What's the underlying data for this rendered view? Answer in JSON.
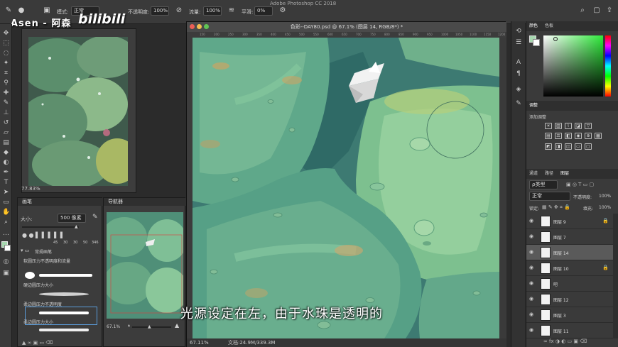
{
  "app": {
    "title": "Adobe Photoshop CC 2018"
  },
  "watermark": {
    "name": "Asen - 阿森",
    "logo": "bilibili"
  },
  "options_bar": {
    "mode_label": "模式:",
    "mode_value": "正常",
    "opacity_label": "不透明度:",
    "opacity_value": "100%",
    "flow_label": "流量:",
    "flow_value": "100%",
    "smooth_label": "平滑:",
    "smooth_value": "0%"
  },
  "reference_doc": {
    "zoom": "77.83%"
  },
  "brush_panel": {
    "tab": "画笔",
    "size_label": "大小:",
    "size_value": "500 像素",
    "preset_sizes": [
      "45",
      "30",
      "30",
      "50",
      "346"
    ],
    "group_name": "常规画笔",
    "items": [
      "软圆压力不透明度和流量",
      "硬边圆压力大小",
      "柔边圆压力不透明度",
      "柔边圆压力大小"
    ]
  },
  "navigator": {
    "tab": "导航器",
    "zoom": "67.1%"
  },
  "document": {
    "title": "色彩--DAY80.psd @ 67.1% (图层 14, RGB/8*) *",
    "status_zoom": "67.11%",
    "status_doc": "文档:24.9M/339.3M",
    "ruler_marks": [
      "150",
      "200",
      "250",
      "300",
      "350",
      "400",
      "450",
      "500",
      "550",
      "600",
      "650",
      "700",
      "750",
      "800",
      "850",
      "900",
      "950",
      "1000",
      "1050",
      "1100",
      "1150",
      "1200"
    ]
  },
  "subtitle": "光源设定在左，由于水珠是透明的",
  "right_panels": {
    "color_tabs": [
      "颜色",
      "色板"
    ],
    "adjust_tab": "调整",
    "adjust_add": "添加调整",
    "layer_tabs": [
      "通道",
      "路径",
      "图层"
    ],
    "kind_label": "ρ类型",
    "blend_mode": "正常",
    "opacity_label": "不透明度:",
    "opacity_value": "100%",
    "lock_label": "锁定:",
    "fill_label": "填充:",
    "fill_value": "100%",
    "layers": [
      {
        "name": "图层 9",
        "selected": false,
        "locked": true
      },
      {
        "name": "图层 7",
        "selected": false,
        "locked": false
      },
      {
        "name": "图层 14",
        "selected": true,
        "locked": false
      },
      {
        "name": "图层 10",
        "selected": false,
        "locked": true
      },
      {
        "name": "吧",
        "selected": false,
        "locked": false
      },
      {
        "name": "图层 12",
        "selected": false,
        "locked": false
      },
      {
        "name": "图层 3",
        "selected": false,
        "locked": false
      },
      {
        "name": "图层 11",
        "selected": false,
        "locked": false
      }
    ]
  },
  "colors": {
    "foreground": "#a8d8b0",
    "canvas_green": "#5fa88a",
    "accent": "#7ec6a4"
  }
}
